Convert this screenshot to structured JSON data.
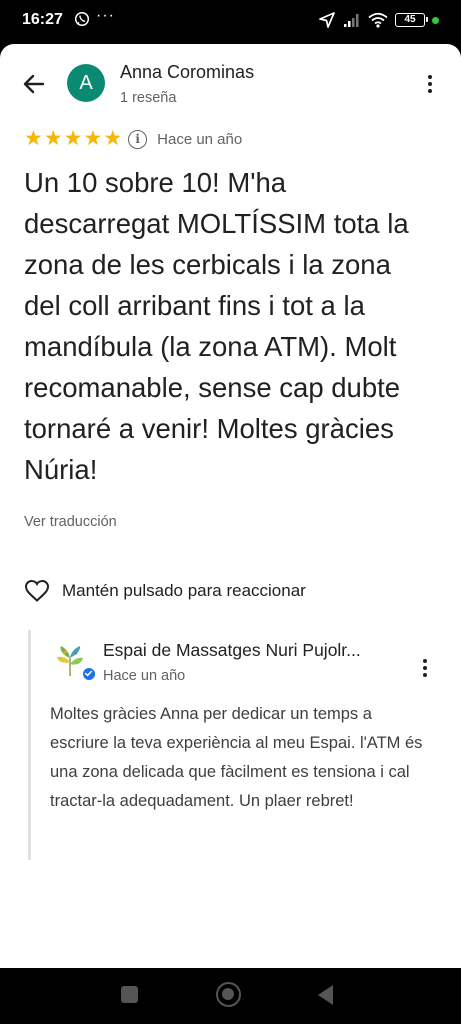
{
  "status_bar": {
    "time": "16:27",
    "extra_indicator": "···",
    "battery": "45"
  },
  "header": {
    "avatar_letter": "A",
    "author_name": "Anna Corominas",
    "author_meta": "1 reseña"
  },
  "review": {
    "rating": 5,
    "max_rating": 5,
    "time_ago": "Hace un año",
    "text": "Un 10 sobre 10! M'ha descarregat MOLTÍSSIM tota la zona de les cerbicals i la zona del coll arribant fins i tot a la mandíbula (la zona ATM). Molt recomanable, sense cap dubte tornaré a venir! Moltes gràcies Núria!",
    "translate_label": "Ver traducción"
  },
  "reaction": {
    "label": "Mantén pulsado para reaccionar"
  },
  "owner_reply": {
    "business_name": "Espai de Massatges Nuri Pujolr...",
    "time_ago": "Hace un año",
    "text": "Moltes gràcies Anna per dedicar un temps a escriure la teva experiència al meu Espai. l'ATM és una zona delicada que fàcilment es tensiona i cal tractar-la adequadament. Un plaer rebret!"
  },
  "colors": {
    "avatar_bg": "#0a8a72",
    "star": "#f6b704",
    "verified": "#1a73e8",
    "battery_dot": "#2ecc40"
  },
  "icons": [
    "back-arrow-icon",
    "more-vert-icon",
    "star-icon",
    "info-icon",
    "heart-outline-icon",
    "verified-badge-icon",
    "whatsapp-icon",
    "location-arrow-icon",
    "signal-icon",
    "wifi-icon",
    "battery-icon"
  ]
}
